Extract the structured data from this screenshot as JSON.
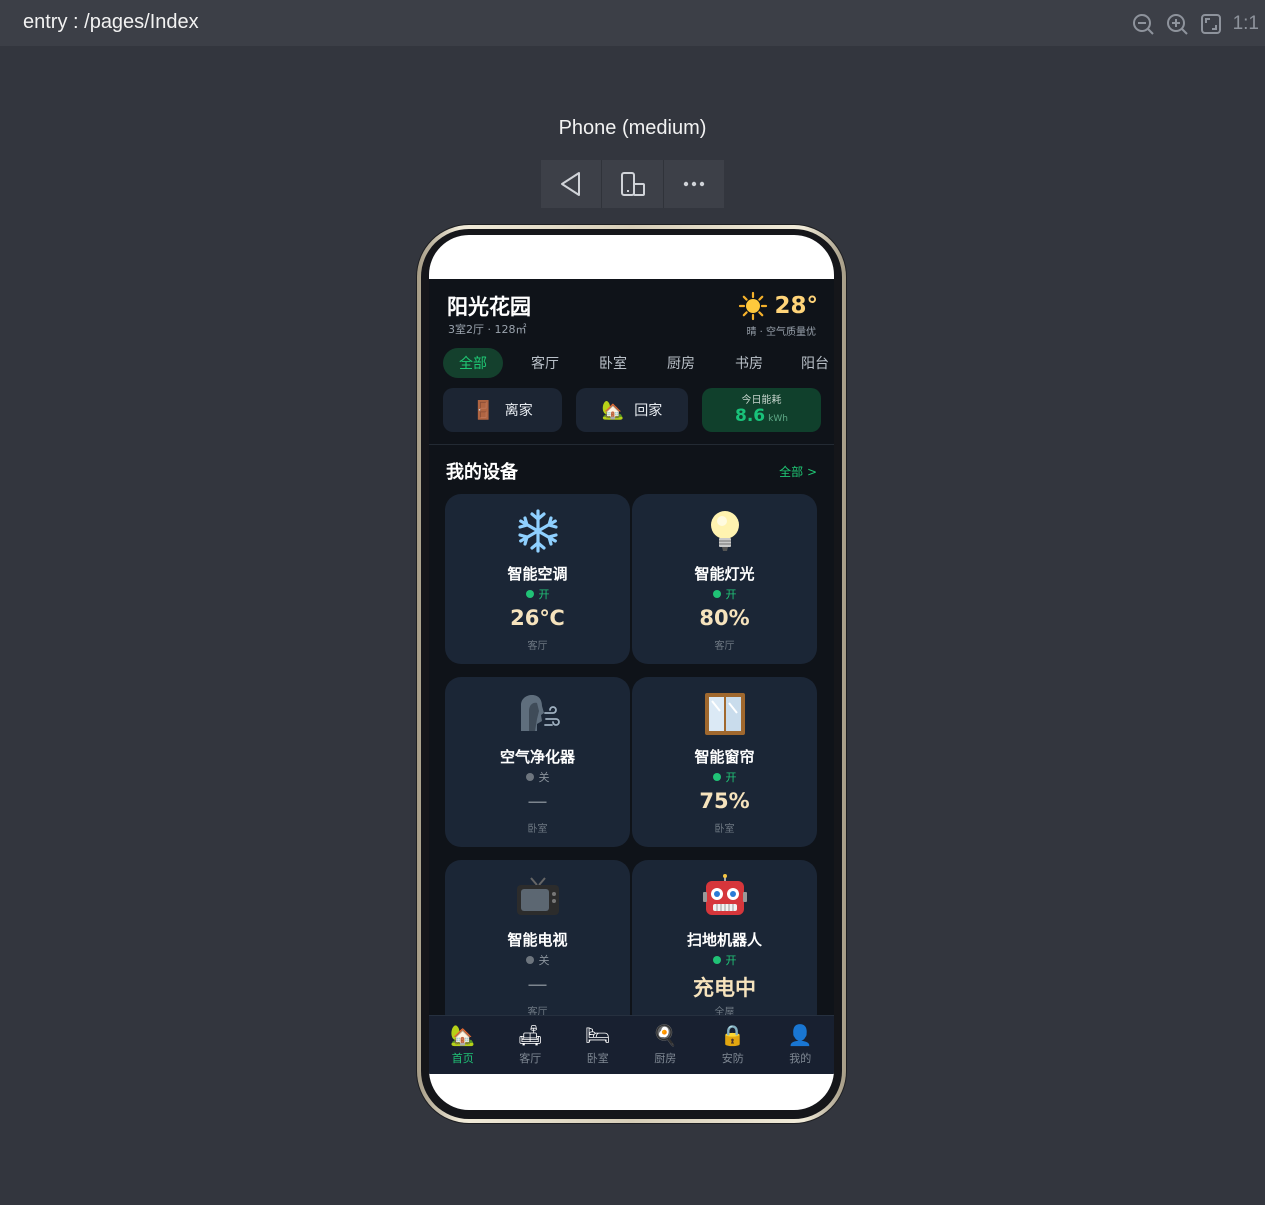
{
  "preview": {
    "entry_path": "entry : /pages/Index",
    "device_label": "Phone (medium)",
    "zoom_tools": [
      "zoom-out-icon",
      "zoom-in-icon",
      "fit-screen-icon"
    ],
    "actual_size_label": "1:1"
  },
  "header": {
    "title": "阳光花园",
    "subtitle": "3室2厅 · 128㎡",
    "temperature": "28°",
    "weather_sub": "晴 · 空气质量优"
  },
  "tabs": [
    "全部",
    "客厅",
    "卧室",
    "厨房",
    "书房",
    "阳台"
  ],
  "active_tab": "全部",
  "scenes": {
    "leave": {
      "icon": "🚪",
      "label": "离家"
    },
    "home": {
      "icon": "🏡",
      "label": "回家"
    },
    "energy": {
      "label": "今日能耗",
      "value": "8.6",
      "unit": "kWh"
    }
  },
  "devices_section": {
    "title": "我的设备",
    "more": "全部 >"
  },
  "devices": [
    {
      "name": "智能空调",
      "icon": "snowflake-icon",
      "status": "开",
      "on": true,
      "value": "26℃",
      "room": "客厅"
    },
    {
      "name": "智能灯光",
      "icon": "light-bulb-icon",
      "status": "开",
      "on": true,
      "value": "80%",
      "room": "客厅"
    },
    {
      "name": "空气净化器",
      "icon": "air-purifier-icon",
      "status": "关",
      "on": false,
      "value": "—",
      "room": "卧室"
    },
    {
      "name": "智能窗帘",
      "icon": "window-icon",
      "status": "开",
      "on": true,
      "value": "75%",
      "room": "卧室"
    },
    {
      "name": "智能电视",
      "icon": "tv-icon",
      "status": "关",
      "on": false,
      "value": "—",
      "room": "客厅"
    },
    {
      "name": "扫地机器人",
      "icon": "robot-icon",
      "status": "开",
      "on": true,
      "value": "充电中",
      "room": "全屋"
    }
  ],
  "nav": [
    {
      "icon": "🏡",
      "label": "首页",
      "active": true
    },
    {
      "icon": "🛋",
      "label": "客厅",
      "active": false
    },
    {
      "icon": "🛏",
      "label": "卧室",
      "active": false
    },
    {
      "icon": "🍳",
      "label": "厨房",
      "active": false
    },
    {
      "icon": "🔒",
      "label": "安防",
      "active": false
    },
    {
      "icon": "👤",
      "label": "我的",
      "active": false
    }
  ],
  "colors": {
    "accent": "#1fc774",
    "card": "#1b2636",
    "background": "#0f1319",
    "value": "#f6e3bd"
  }
}
